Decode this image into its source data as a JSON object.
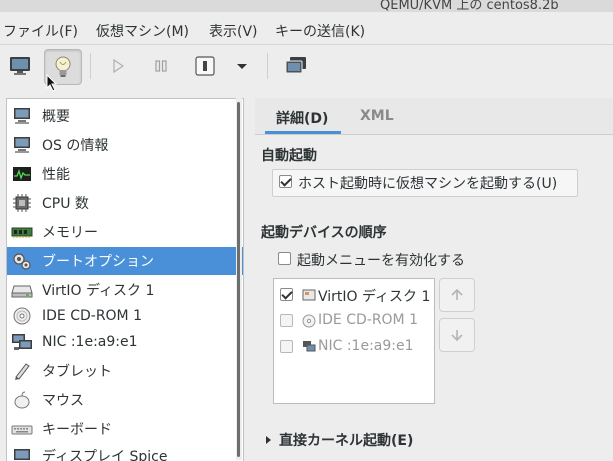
{
  "window": {
    "title": "QEMU/KVM 上の centos8.2b"
  },
  "menubar": {
    "items": [
      {
        "label": "ファイル(F)"
      },
      {
        "label": "仮想マシン(M)"
      },
      {
        "label": "表示(V)"
      },
      {
        "label": "キーの送信(K)"
      }
    ]
  },
  "toolbar": {
    "buttons": [
      {
        "icon": "monitor-icon"
      },
      {
        "icon": "lightbulb-icon",
        "pressed": true
      },
      {
        "icon": "play-icon"
      },
      {
        "icon": "pause-icon"
      },
      {
        "icon": "power-icon"
      },
      {
        "icon": "chevron-down-icon"
      },
      {
        "icon": "screens-icon"
      }
    ]
  },
  "hardware_list": {
    "items": [
      {
        "label": "概要",
        "icon": "overview-monitor-icon"
      },
      {
        "label": "OS の情報",
        "icon": "os-info-icon"
      },
      {
        "label": "性能",
        "icon": "performance-graph-icon"
      },
      {
        "label": "CPU 数",
        "icon": "cpu-chip-icon"
      },
      {
        "label": "メモリー",
        "icon": "memory-icon"
      },
      {
        "label": "ブートオプション",
        "icon": "boot-options-icon",
        "selected": true
      },
      {
        "label": "VirtIO ディスク 1",
        "icon": "disk-icon"
      },
      {
        "label": "IDE CD-ROM 1",
        "icon": "cdrom-icon"
      },
      {
        "label": "NIC :1e:a9:e1",
        "icon": "nic-icon"
      },
      {
        "label": "タブレット",
        "icon": "tablet-icon"
      },
      {
        "label": "マウス",
        "icon": "mouse-icon"
      },
      {
        "label": "キーボード",
        "icon": "keyboard-icon"
      },
      {
        "label": "ディスプレイ Spice",
        "icon": "display-icon"
      }
    ]
  },
  "tabs": [
    {
      "label": "詳細(D)",
      "active": true
    },
    {
      "label": "XML",
      "active": false
    }
  ],
  "autostart": {
    "title": "自動起動",
    "checkbox_label": "ホスト起動時に仮想マシンを起動する(U)",
    "checked": true
  },
  "boot_order": {
    "title": "起動デバイスの順序",
    "menu_checkbox_label": "起動メニューを有効化する",
    "menu_checked": false,
    "devices": [
      {
        "label": "VirtIO ディスク 1",
        "checked": true,
        "enabled": true,
        "icon": "disk-small-icon"
      },
      {
        "label": "IDE CD-ROM 1",
        "checked": false,
        "enabled": false,
        "icon": "cdrom-small-icon"
      },
      {
        "label": "NIC :1e:a9:e1",
        "checked": false,
        "enabled": false,
        "icon": "nic-small-icon"
      }
    ]
  },
  "direct_kernel_boot": {
    "label": "直接カーネル起動(E)"
  },
  "colors": {
    "accent": "#4a90d9",
    "selected_text": "#ffffff"
  }
}
